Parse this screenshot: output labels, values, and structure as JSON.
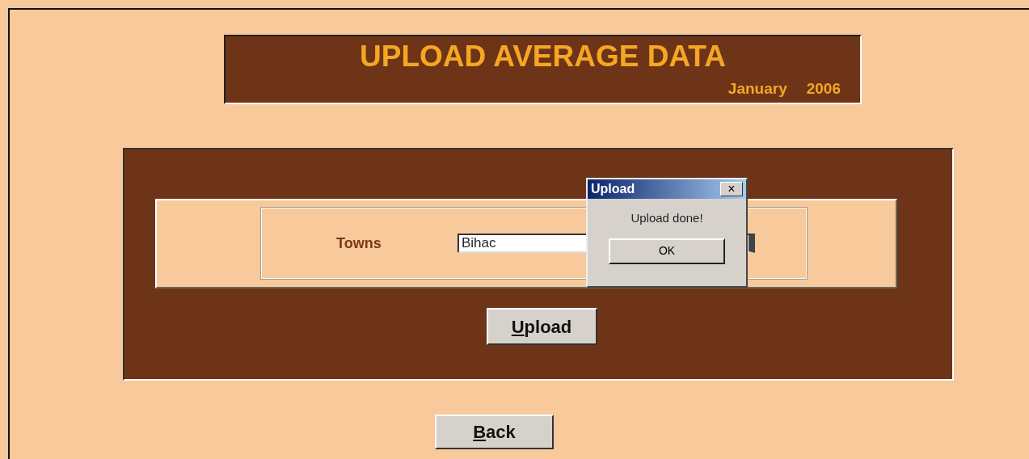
{
  "header": {
    "title": "UPLOAD AVERAGE DATA",
    "month": "January",
    "year": "2006"
  },
  "form": {
    "label": "Towns",
    "value": "Bihac"
  },
  "upload_button": {
    "label": "Upload",
    "access_key_underlined": true
  },
  "back_button": {
    "label": "Back",
    "access_key_underlined": true
  },
  "dialog": {
    "title": "Upload",
    "close": "×",
    "message": "Upload done!",
    "button": "OK"
  }
}
